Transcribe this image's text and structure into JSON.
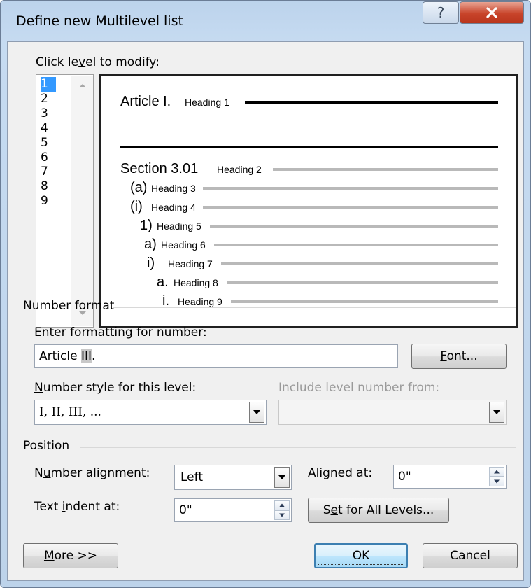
{
  "window": {
    "title": "Define new Multilevel list",
    "help_glyph": "?",
    "close_glyph": "X",
    "colors": {
      "titlebar": "#c6dbf1",
      "close": "#c8442a",
      "selection": "#3399ff",
      "default_button": "#bee6fd"
    }
  },
  "levels": {
    "label_pre": "Click le",
    "label_u": "v",
    "label_post": "el to modify:",
    "items": [
      "1",
      "2",
      "3",
      "4",
      "5",
      "6",
      "7",
      "8",
      "9"
    ],
    "selected": "1"
  },
  "preview": {
    "rows": [
      {
        "number": "Article I.",
        "style": "Heading 1"
      },
      {
        "number": "Section 3.01",
        "style": "Heading 2"
      },
      {
        "number": "(a)",
        "style": "Heading 3"
      },
      {
        "number": "(i)",
        "style": "Heading 4"
      },
      {
        "number": "1)",
        "style": "Heading 5"
      },
      {
        "number": "a)",
        "style": "Heading 6"
      },
      {
        "number": "i)",
        "style": "Heading 7"
      },
      {
        "number": "a.",
        "style": "Heading 8"
      },
      {
        "number": "i.",
        "style": "Heading 9"
      }
    ]
  },
  "number_format": {
    "section": "Number format",
    "enter_label_pre": "Enter f",
    "enter_label_u": "o",
    "enter_label_post": "rmatting for number:",
    "value_prefix": "Article ",
    "value_number": "III",
    "value_suffix": ".",
    "font_button_u": "F",
    "font_button_rest": "ont...",
    "style_label_u": "N",
    "style_label_rest": "umber style for this level:",
    "style_value": "I, II, III, ...",
    "include_label": "Include level number from:",
    "include_value": ""
  },
  "position": {
    "section": "Position",
    "alignment_label_pre": "N",
    "alignment_label_u": "u",
    "alignment_label_post": "mber alignment:",
    "alignment_value": "Left",
    "aligned_at_label_u": "A",
    "aligned_at_label_rest": "ligned at:",
    "aligned_at_value": "0\"",
    "indent_label_pre": "Text ",
    "indent_label_u": "i",
    "indent_label_post": "ndent at:",
    "indent_value": "0\"",
    "set_all_pre": "S",
    "set_all_u": "e",
    "set_all_post": "t for All Levels..."
  },
  "footer": {
    "more_u": "M",
    "more_rest": "ore >>",
    "ok": "OK",
    "cancel": "Cancel"
  }
}
